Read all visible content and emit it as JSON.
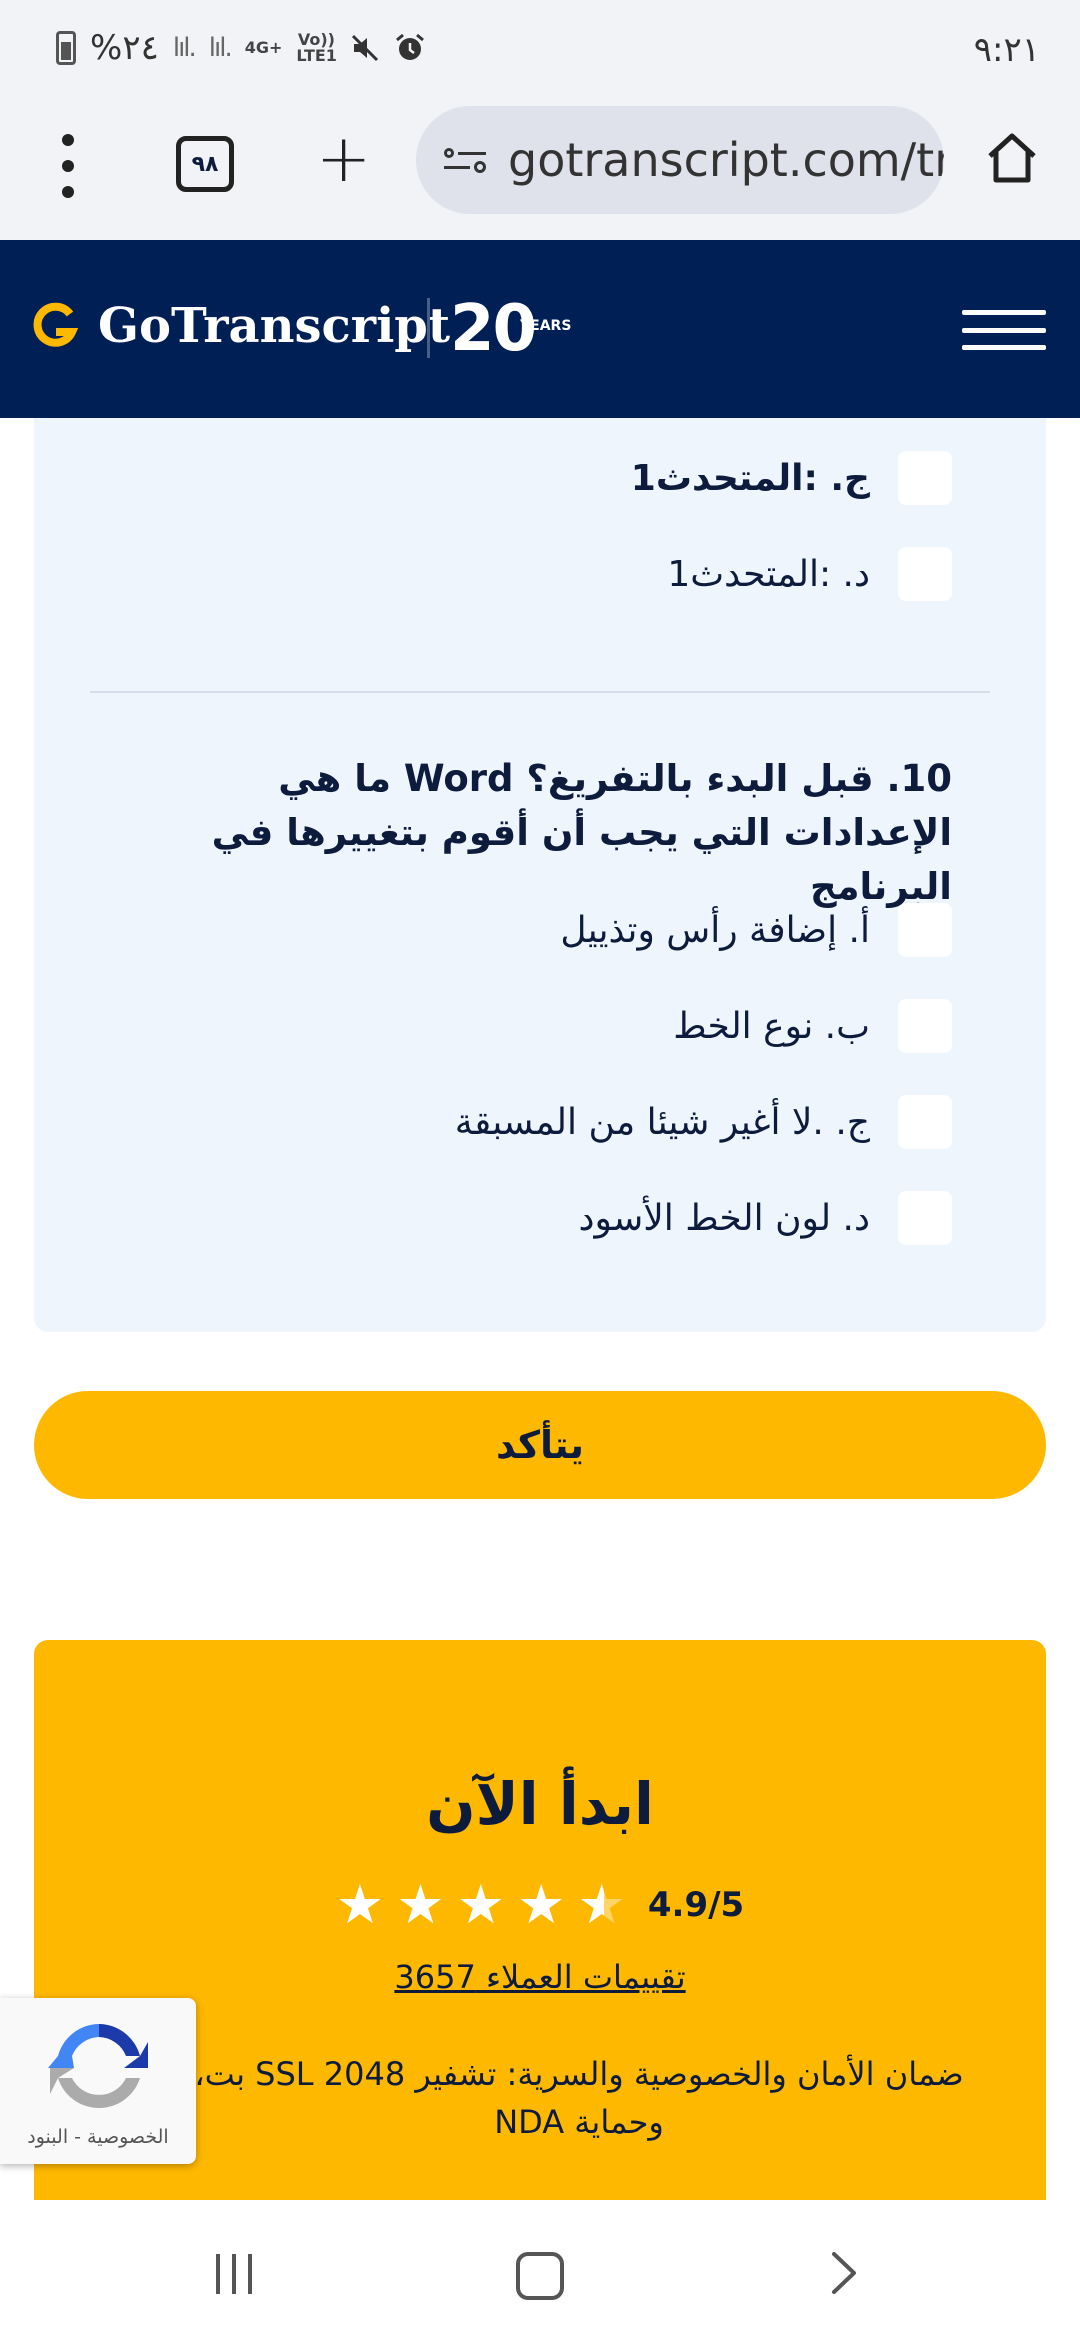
{
  "status_bar": {
    "battery_percent": "%٢٤",
    "signal_1": "lıl.",
    "signal_2": "lıl.",
    "network_1": "4G+",
    "network_2": "Vo)) LTE1",
    "time": "٩:٢١"
  },
  "browser": {
    "tab_count": "٩٨",
    "url": "gotranscript.com/tr",
    "icons": [
      "more-vert-icon",
      "tabs-icon",
      "add-icon",
      "site-settings-icon",
      "home-icon"
    ]
  },
  "site_header": {
    "brand": "GoTranscript",
    "anniversary_number": "20",
    "anniversary_label": "YEARS"
  },
  "quiz": {
    "prev_options": [
      {
        "label": "ج. :المتحدث1",
        "bold": true
      },
      {
        "label": "د. :المتحدث1",
        "bold": false
      }
    ],
    "question": "10. قبل البدء بالتفريغ؟ Word ما هي الإعدادات التي يجب أن أقوم بتغييرها في البرنامج",
    "options": [
      {
        "label": "أ. إضافة رأس وتذييل"
      },
      {
        "label": "ب. نوع الخط"
      },
      {
        "label": "ج. .لا أغير شيئا من المسبقة"
      },
      {
        "label": "د. لون الخط الأسود"
      }
    ]
  },
  "confirm_button": "يتأكد",
  "start_card": {
    "title": "ابدأ الآن",
    "rating": "4.9/5",
    "stars": 4.5,
    "reviews_link": "تقييمات العملاء 3657",
    "security_text": "ضمان الأمان والخصوصية والسرية: تشفير SSL 2048 بت، وحماية NDA"
  },
  "recaptcha": {
    "links": "الخصوصية - البنود"
  },
  "colors": {
    "header_bg": "#001f55",
    "accent": "#ffb800",
    "panel_bg": "#eef5fd",
    "text": "#0d1b3d"
  }
}
